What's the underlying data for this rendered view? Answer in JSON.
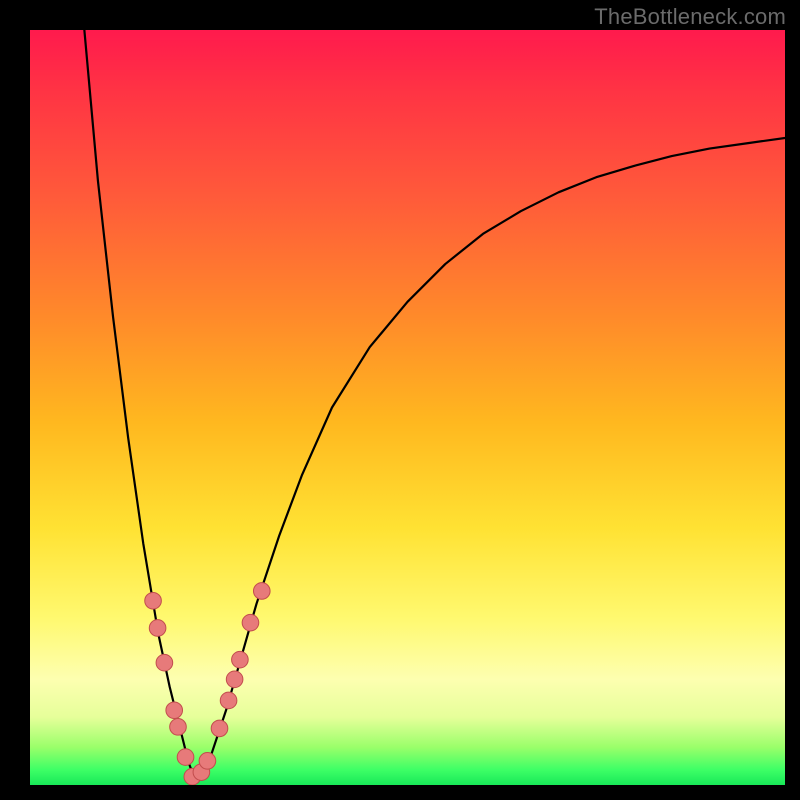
{
  "watermark": "TheBottleneck.com",
  "colors": {
    "frame": "#000000",
    "curve": "#000000",
    "marker_fill": "#e77a7a",
    "marker_stroke": "#c24d4d",
    "gradient_top": "#ff1a4d",
    "gradient_bottom": "#18e858"
  },
  "chart_data": {
    "type": "line",
    "title": "",
    "xlabel": "",
    "ylabel": "",
    "xlim": [
      0,
      100
    ],
    "ylim": [
      0,
      100
    ],
    "grid": false,
    "legend": false,
    "series": [
      {
        "name": "curve",
        "x": [
          7.2,
          9.0,
          11.0,
          13.0,
          15.0,
          17.0,
          18.5,
          20.0,
          21.0,
          22.0,
          23.0,
          24.0,
          26.0,
          28.0,
          30.0,
          33.0,
          36.0,
          40.0,
          45.0,
          50.0,
          55.0,
          60.0,
          65.0,
          70.0,
          75.0,
          80.0,
          85.0,
          90.0,
          95.0,
          100.0
        ],
        "y": [
          100.0,
          80.0,
          62.0,
          46.0,
          32.0,
          20.0,
          13.0,
          7.0,
          3.0,
          0.3,
          1.5,
          4.0,
          10.0,
          17.0,
          24.0,
          33.0,
          41.0,
          50.0,
          58.0,
          64.0,
          69.0,
          73.0,
          76.0,
          78.5,
          80.5,
          82.0,
          83.3,
          84.3,
          85.0,
          85.7
        ]
      }
    ],
    "markers": [
      {
        "x": 16.3,
        "y": 24.4,
        "r": 1.1
      },
      {
        "x": 16.9,
        "y": 20.8,
        "r": 1.1
      },
      {
        "x": 17.8,
        "y": 16.2,
        "r": 1.1
      },
      {
        "x": 19.1,
        "y": 9.9,
        "r": 1.1
      },
      {
        "x": 19.6,
        "y": 7.7,
        "r": 1.1
      },
      {
        "x": 20.6,
        "y": 3.7,
        "r": 1.1
      },
      {
        "x": 21.5,
        "y": 1.1,
        "r": 1.1
      },
      {
        "x": 22.7,
        "y": 1.7,
        "r": 1.1
      },
      {
        "x": 23.5,
        "y": 3.2,
        "r": 1.1
      },
      {
        "x": 25.1,
        "y": 7.5,
        "r": 1.1
      },
      {
        "x": 26.3,
        "y": 11.2,
        "r": 1.1
      },
      {
        "x": 27.1,
        "y": 14.0,
        "r": 1.1
      },
      {
        "x": 27.8,
        "y": 16.6,
        "r": 1.1
      },
      {
        "x": 29.2,
        "y": 21.5,
        "r": 1.1
      },
      {
        "x": 30.7,
        "y": 25.7,
        "r": 1.1
      }
    ]
  }
}
